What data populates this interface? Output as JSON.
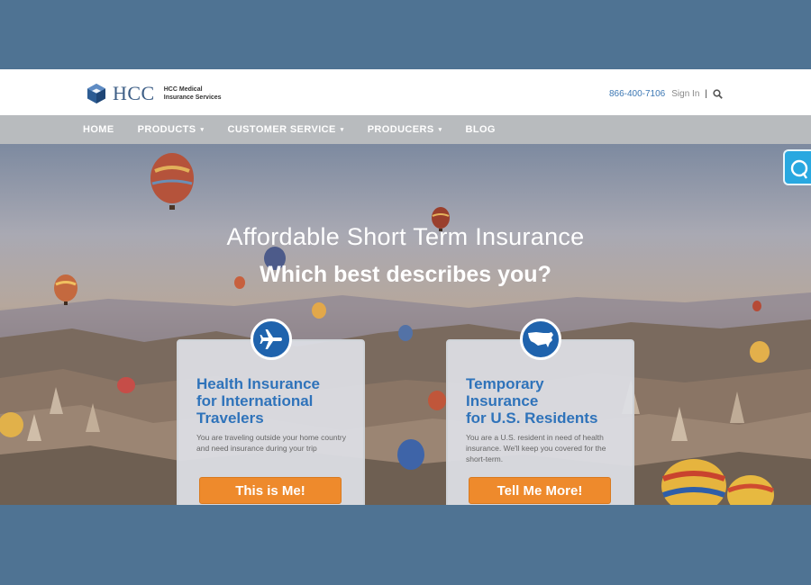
{
  "header": {
    "brand": "HCC",
    "brand_sub_1": "HCC Medical",
    "brand_sub_2": "Insurance Services",
    "phone": "866-400-7106",
    "signin": "Sign In",
    "separator": "|"
  },
  "nav": {
    "items": [
      {
        "label": "HOME",
        "dropdown": false
      },
      {
        "label": "PRODUCTS",
        "dropdown": true
      },
      {
        "label": "CUSTOMER SERVICE",
        "dropdown": true
      },
      {
        "label": "PRODUCERS",
        "dropdown": true
      },
      {
        "label": "BLOG",
        "dropdown": false
      }
    ],
    "caret": "▾"
  },
  "hero": {
    "title": "Affordable Short Term Insurance",
    "subtitle": "Which best describes you?"
  },
  "cards": [
    {
      "icon": "airplane-icon",
      "title_1": "Health Insurance",
      "title_2": "for International",
      "title_3": "Travelers",
      "description": "You are traveling outside your home country and need insurance during your trip",
      "button": "This is Me!"
    },
    {
      "icon": "usa-map-icon",
      "title_1": "Temporary",
      "title_2": "Insurance",
      "title_3": "for U.S. Residents",
      "description": "You are a U.S. resident in need of health insurance. We'll keep you covered for the short-term.",
      "button": "Tell Me More!"
    }
  ],
  "colors": {
    "accent_blue": "#2f73ba",
    "button_orange": "#ee8a2c",
    "nav_bg": "#b8bbbe",
    "frame_bg": "#4f7393",
    "chat_tab": "#29a8e0"
  }
}
